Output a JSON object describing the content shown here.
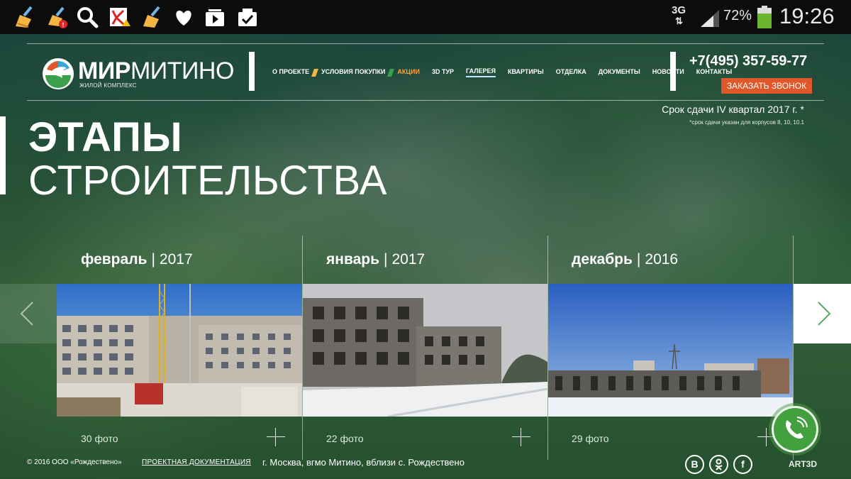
{
  "status_bar": {
    "icons": [
      "cleaner-icon",
      "cleaner-alert-icon",
      "search-icon",
      "antivirus-icon",
      "cleaner-icon",
      "heart-icon",
      "video-icon",
      "clipboard-check-icon"
    ],
    "network": "3G",
    "battery_percent": "72%",
    "battery_level": 0.72,
    "time": "19:26"
  },
  "header": {
    "logo_bold": "МИР",
    "logo_light": "МИТИНО",
    "logo_sub": "ЖИЛОЙ КОМПЛЕКС",
    "nav": [
      {
        "label": "О ПРОЕКТЕ"
      },
      {
        "label": "УСЛОВИЯ ПОКУПКИ"
      },
      {
        "label": "АКЦИИ"
      },
      {
        "label": "3D ТУР"
      },
      {
        "label": "ГАЛЕРЕЯ"
      },
      {
        "label": "КВАРТИРЫ"
      },
      {
        "label": "ОТДЕЛКА"
      },
      {
        "label": "ДОКУМЕНТЫ"
      },
      {
        "label": "НОВОСТИ"
      },
      {
        "label": "КОНТАКТЫ"
      }
    ],
    "phone": "+7(495) 357-59-77",
    "callback_button": "ЗАКАЗАТЬ ЗВОНОК",
    "deadline": "Срок сдачи IV квартал 2017 г. *",
    "footnote": "*срок сдачи указан для корпусов 8, 10, 10.1"
  },
  "title": {
    "line1": "ЭТАПЫ",
    "line2": "СТРОИТЕЛЬСТВА"
  },
  "gallery": [
    {
      "month": "февраль",
      "year": "2017",
      "count": "30 фото"
    },
    {
      "month": "январь",
      "year": "2017",
      "count": "22 фото"
    },
    {
      "month": "декабрь",
      "year": "2016",
      "count": "29 фото"
    }
  ],
  "footer": {
    "copyright": "© 2016 ООО «Рождествено»",
    "docs_link": "ПРОЕКТНАЯ ДОКУМЕНТАЦИЯ",
    "address": "г. Москва, вгмо Митино, вблизи с. Рождествено",
    "social": [
      "В",
      "ok-icon",
      "f"
    ],
    "brand": "ART3D"
  },
  "colors": {
    "accent_orange": "#e0582a",
    "nav_accent": "#ffa23b",
    "call_green": "#42a03e"
  }
}
